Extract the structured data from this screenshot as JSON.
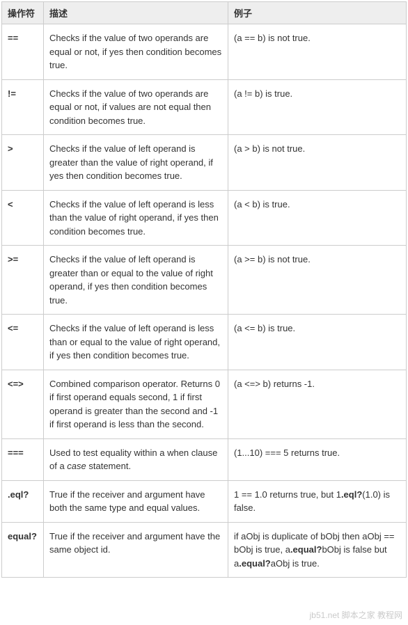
{
  "headers": {
    "operator": "操作符",
    "description": "描述",
    "example": "例子"
  },
  "rows": [
    {
      "op": "==",
      "desc": "Checks if the value of two operands are equal or not, if yes then condition becomes true.",
      "ex": "(a == b) is not true."
    },
    {
      "op": "!=",
      "desc": "Checks if the value of two operands are equal or not, if values are not equal then condition becomes true.",
      "ex": "(a != b) is true."
    },
    {
      "op": ">",
      "desc": "Checks if the value of left operand is greater than the value of right operand, if yes then condition becomes true.",
      "ex": "(a > b) is not true."
    },
    {
      "op": "<",
      "desc": "Checks if the value of left operand is less than the value of right operand, if yes then condition becomes true.",
      "ex": "(a < b) is true."
    },
    {
      "op": ">=",
      "desc": "Checks if the value of left operand is greater than or equal to the value of right operand, if yes then condition becomes true.",
      "ex": "(a >= b) is not true."
    },
    {
      "op": "<=",
      "desc": "Checks if the value of left operand is less than or equal to the value of right operand, if yes then condition becomes true.",
      "ex": "(a <= b) is true."
    },
    {
      "op": "<=>",
      "desc": "Combined comparison operator. Returns 0 if first operand equals second, 1 if first operand is greater than the second and -1 if first operand is less than the second.",
      "ex": "(a <=> b) returns -1."
    },
    {
      "op": "===",
      "desc_html": "Used to test equality within a when clause of a <span class=\"emph\">case</span> statement.",
      "ex": "(1...10) === 5 returns true."
    },
    {
      "op": ".eql?",
      "desc": "True if the receiver and argument have both the same type and equal values.",
      "ex_html": "1 == 1.0 returns true, but 1<span class=\"bold\">.eql?</span>(1.0) is false."
    },
    {
      "op": "equal?",
      "desc": "True if the receiver and argument have the same object id.",
      "ex_html": "if aObj is duplicate of bObj then aObj == bObj is true, a<span class=\"bold\">.equal?</span>bObj is false but a<span class=\"bold\">.equal?</span>aObj is true."
    }
  ],
  "watermark": "jb51.net 脚本之家 教程网"
}
